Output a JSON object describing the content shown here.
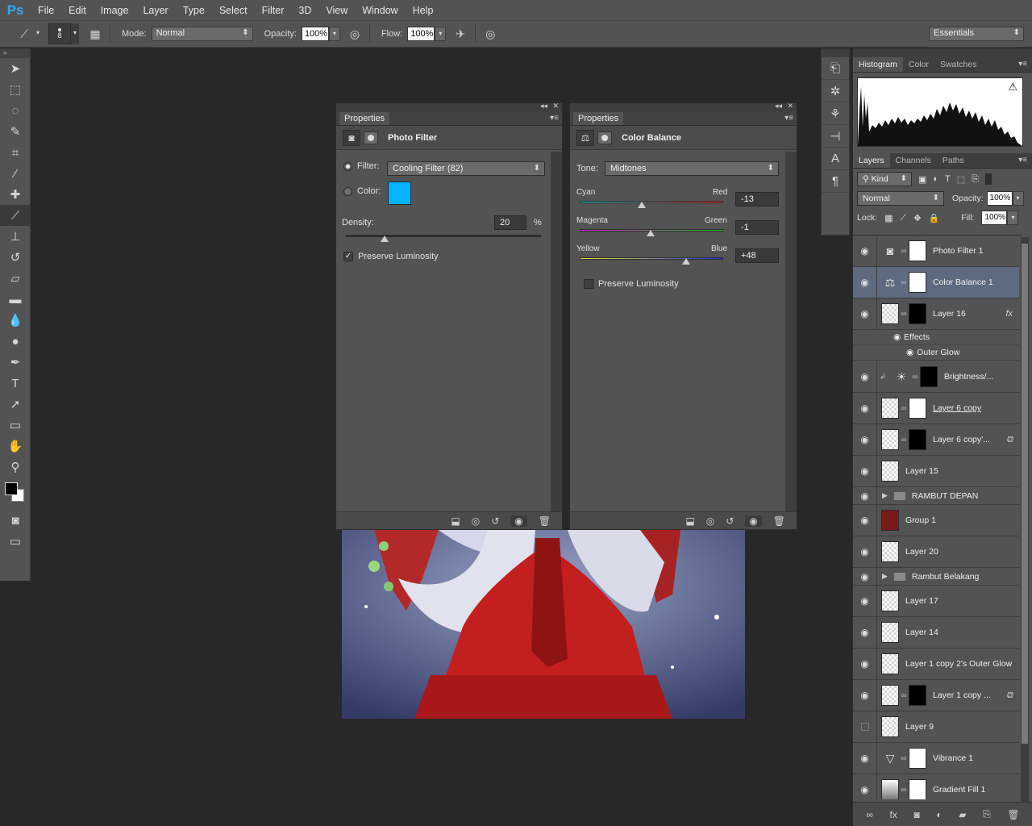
{
  "app": {
    "logo": "Ps"
  },
  "menu": [
    "File",
    "Edit",
    "Image",
    "Layer",
    "Type",
    "Select",
    "Filter",
    "3D",
    "View",
    "Window",
    "Help"
  ],
  "options_bar": {
    "brush_size": "8",
    "mode_label": "Mode:",
    "mode_value": "Normal",
    "opacity_label": "Opacity:",
    "opacity_value": "100%",
    "flow_label": "Flow:",
    "flow_value": "100%",
    "workspace": "Essentials"
  },
  "photo_filter_panel": {
    "tab": "Properties",
    "title": "Photo Filter",
    "filter_label": "Filter:",
    "filter_value": "Cooling Filter (82)",
    "color_label": "Color:",
    "swatch_color": "#00b4ff",
    "density_label": "Density:",
    "density_value": "20",
    "density_unit": "%",
    "density_fraction": 0.2,
    "preserve_label": "Preserve Luminosity",
    "preserve_checked": true
  },
  "color_balance_panel": {
    "tab": "Properties",
    "title": "Color Balance",
    "tone_label": "Tone:",
    "tone_value": "Midtones",
    "sliders": [
      {
        "left": "Cyan",
        "right": "Red",
        "value": "-13",
        "level": -13
      },
      {
        "left": "Magenta",
        "right": "Green",
        "value": "-1",
        "level": -1
      },
      {
        "left": "Yellow",
        "right": "Blue",
        "value": "+48",
        "level": 48
      }
    ],
    "preserve_label": "Preserve Luminosity",
    "preserve_checked": false
  },
  "histogram_panel": {
    "tabs": [
      "Histogram",
      "Color",
      "Swatches"
    ],
    "warning_icon": "warning-icon"
  },
  "layers_panel": {
    "tabs": [
      "Layers",
      "Channels",
      "Paths"
    ],
    "kind_label": "Kind",
    "blend_mode": "Normal",
    "opacity_label": "Opacity:",
    "opacity_value": "100%",
    "lock_label": "Lock:",
    "fill_label": "Fill:",
    "fill_value": "100%",
    "layers": [
      {
        "name": "Photo Filter 1"
      },
      {
        "name": "Color Balance 1"
      },
      {
        "name": "Layer 16"
      },
      {
        "name": "Effects"
      },
      {
        "name": "Outer Glow"
      },
      {
        "name": "Brightness/..."
      },
      {
        "name": "Layer 6 copy"
      },
      {
        "name": "Layer 6 copy'..."
      },
      {
        "name": "Layer 15"
      },
      {
        "name": "RAMBUT DEPAN"
      },
      {
        "name": "Group 1"
      },
      {
        "name": "Layer 20"
      },
      {
        "name": "Rambut Belakang"
      },
      {
        "name": "Layer 17"
      },
      {
        "name": "Layer 14"
      },
      {
        "name": "Layer 1 copy 2's Outer Glow"
      },
      {
        "name": "Layer 1 copy ..."
      },
      {
        "name": "Layer 9"
      },
      {
        "name": "Vibrance 1"
      },
      {
        "name": "Gradient Fill 1"
      }
    ]
  }
}
